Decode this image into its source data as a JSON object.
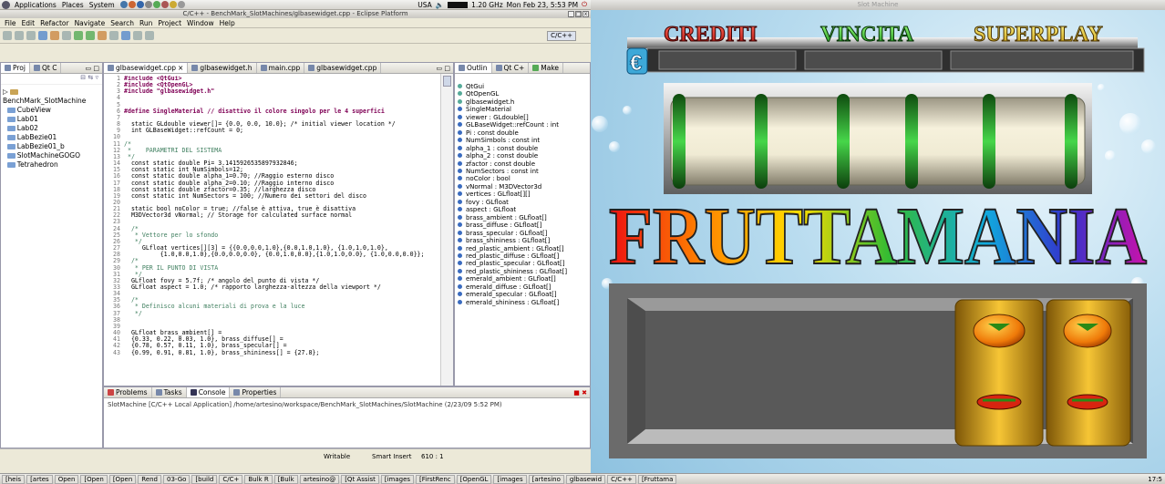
{
  "top_panel": {
    "menus": [
      "Applications",
      "Places",
      "System"
    ],
    "locale": "USA",
    "cpu": "1.20 GHz",
    "datetime": "Mon Feb 23,  5:53 PM"
  },
  "eclipse": {
    "title": "C/C++ - BenchMark_SlotMachines/glbasewidget.cpp - Eclipse Platform",
    "menus": [
      "File",
      "Edit",
      "Refactor",
      "Navigate",
      "Search",
      "Run",
      "Project",
      "Window",
      "Help"
    ],
    "perspective": "C/C++",
    "project_tabs": [
      "Proj",
      "Qt C"
    ],
    "project_tree": [
      "BenchMark_SlotMachine",
      "CubeView",
      "Lab01",
      "Lab02",
      "LabBezie01",
      "LabBezie01_b",
      "SlotMachineGOGO",
      "Tetrahedron"
    ],
    "editor_tabs": [
      "glbasewidget.cpp",
      "glbasewidget.h",
      "main.cpp",
      "glbasewidget.cpp"
    ],
    "outline_tabs": [
      "Outlin",
      "Qt C+",
      "Make"
    ],
    "outline_items": [
      "QtGui",
      "QtOpenGL",
      "glbasewidget.h",
      "SingleMaterial",
      "viewer : GLdouble[]",
      "GLBaseWidget::refCount : int",
      "Pi : const double",
      "NumSimbols : const int",
      "alpha_1 : const double",
      "alpha_2 : const double",
      "zfactor : const double",
      "NumSectors : const int",
      "noColor : bool",
      "vNormal : M3DVector3d",
      "vertices : GLfloat[][]",
      "fovy : GLfloat",
      "aspect : GLfloat",
      "brass_ambient : GLfloat[]",
      "brass_diffuse : GLfloat[]",
      "brass_specular : GLfloat[]",
      "brass_shininess : GLfloat[]",
      "red_plastic_ambient : GLfloat[]",
      "red_plastic_diffuse : GLfloat[]",
      "red_plastic_specular : GLfloat[]",
      "red_plastic_shininess : GLfloat[]",
      "emerald_ambient : GLfloat[]",
      "emerald_diffuse : GLfloat[]",
      "emerald_specular : GLfloat[]",
      "emerald_shininess : GLfloat[]"
    ],
    "bottom_tabs": [
      "Problems",
      "Tasks",
      "Console",
      "Properties"
    ],
    "console_text": "SlotMachine [C/C++ Local Application] /home/artesino/workspace/BenchMark_SlotMachines/SlotMachine (2/23/09 5:52 PM)",
    "status": {
      "writable": "Writable",
      "insert": "Smart Insert",
      "position": "610 : 1"
    },
    "code_lines": [
      {
        "n": "1",
        "t": "#include <QtGui>"
      },
      {
        "n": "2",
        "t": "#include <QtOpenGL>"
      },
      {
        "n": "3",
        "t": "#include \"glbasewidget.h\""
      },
      {
        "n": "4",
        "t": ""
      },
      {
        "n": "5",
        "t": ""
      },
      {
        "n": "6",
        "t": "#define SingleMaterial // disattivo il colore singolo per le 4 superfici"
      },
      {
        "n": "7",
        "t": ""
      },
      {
        "n": "8",
        "t": "  static GLdouble viewer[]= {0.0, 0.0, 10.0}; /* initial viewer location */"
      },
      {
        "n": "9",
        "t": "  int GLBaseWidget::refCount = 0;"
      },
      {
        "n": "10",
        "t": ""
      },
      {
        "n": "11",
        "t": "/*"
      },
      {
        "n": "12",
        "t": " *    PARAMETRI DEL SISTEMA"
      },
      {
        "n": "13",
        "t": " */"
      },
      {
        "n": "14",
        "t": "  const static double Pi= 3.1415926535897932846;"
      },
      {
        "n": "15",
        "t": "  const static int NumSimbols=12;"
      },
      {
        "n": "16",
        "t": "  const static double alpha_1=0.70; //Raggio esterno disco"
      },
      {
        "n": "17",
        "t": "  const static double alpha_2=0.10; //Raggio interno disco"
      },
      {
        "n": "18",
        "t": "  const static double zfactor=0.35; //larghezza disco"
      },
      {
        "n": "19",
        "t": "  const static int NumSectors = 100; //Numero dei settori del disco"
      },
      {
        "n": "20",
        "t": ""
      },
      {
        "n": "21",
        "t": "  static bool noColor = true; //false è attiva, true è disattiva"
      },
      {
        "n": "22",
        "t": "  M3DVector3d vNormal; // Storage for calculated surface normal"
      },
      {
        "n": "23",
        "t": ""
      },
      {
        "n": "24",
        "t": "  /*"
      },
      {
        "n": "25",
        "t": "   * Vettore per lo sfondo"
      },
      {
        "n": "26",
        "t": "   */"
      },
      {
        "n": "27",
        "t": "     GLfloat vertices[][3] = {{0.0,0.0,1.0},{0.0,1.0,1.0}, {1.0,1.0,1.0},"
      },
      {
        "n": "28",
        "t": "          {1.0,0.0,1.0},{0.0,0.0,0.0}, {0.0,1.0,0.0},{1.0,1.0,0.0}, {1.0,0.0,0.0}};"
      },
      {
        "n": "29",
        "t": "  /*"
      },
      {
        "n": "30",
        "t": "   * PER IL PUNTO DI VISTA"
      },
      {
        "n": "31",
        "t": "   */"
      },
      {
        "n": "32",
        "t": "  GLfloat fovy = 5.7f; /* angolo del punto di vista */"
      },
      {
        "n": "33",
        "t": "  GLfloat aspect = 1.0; /* rapporto larghezza-altezza della viewport */"
      },
      {
        "n": "34",
        "t": ""
      },
      {
        "n": "35",
        "t": "  /*"
      },
      {
        "n": "36",
        "t": "   * Definisco alcuni materiali di prova e la luce"
      },
      {
        "n": "37",
        "t": "   */"
      },
      {
        "n": "38",
        "t": ""
      },
      {
        "n": "39",
        "t": ""
      },
      {
        "n": "40",
        "t": "  GLfloat brass_ambient[] ="
      },
      {
        "n": "41",
        "t": "  {0.33, 0.22, 0.03, 1.0}, brass_diffuse[] ="
      },
      {
        "n": "42",
        "t": "  {0.78, 0.57, 0.11, 1.0}, brass_specular[] ="
      },
      {
        "n": "43",
        "t": "  {0.99, 0.91, 0.81, 1.0}, brass_shininess[] = {27.8};"
      }
    ]
  },
  "slot": {
    "title": "Slot Machine",
    "labels": [
      "CREDITI",
      "VINCITA",
      "SUPERPLAY"
    ],
    "currency": "€",
    "logo": "FRUTTAMANIA"
  },
  "taskbar": {
    "items": [
      "[heis",
      "[artes",
      "Open",
      "[Open",
      "[Open",
      "Rend",
      "03-Go",
      "[build",
      "C/C+",
      "Bulk R",
      "[Bulk",
      "artesino@",
      "[Qt Assist",
      "[images",
      "[FirstRenc",
      "[OpenGL",
      "[images",
      "[artesino",
      "glbasewid",
      "C/C++",
      "[Fruttama"
    ],
    "clock": "17:5"
  }
}
